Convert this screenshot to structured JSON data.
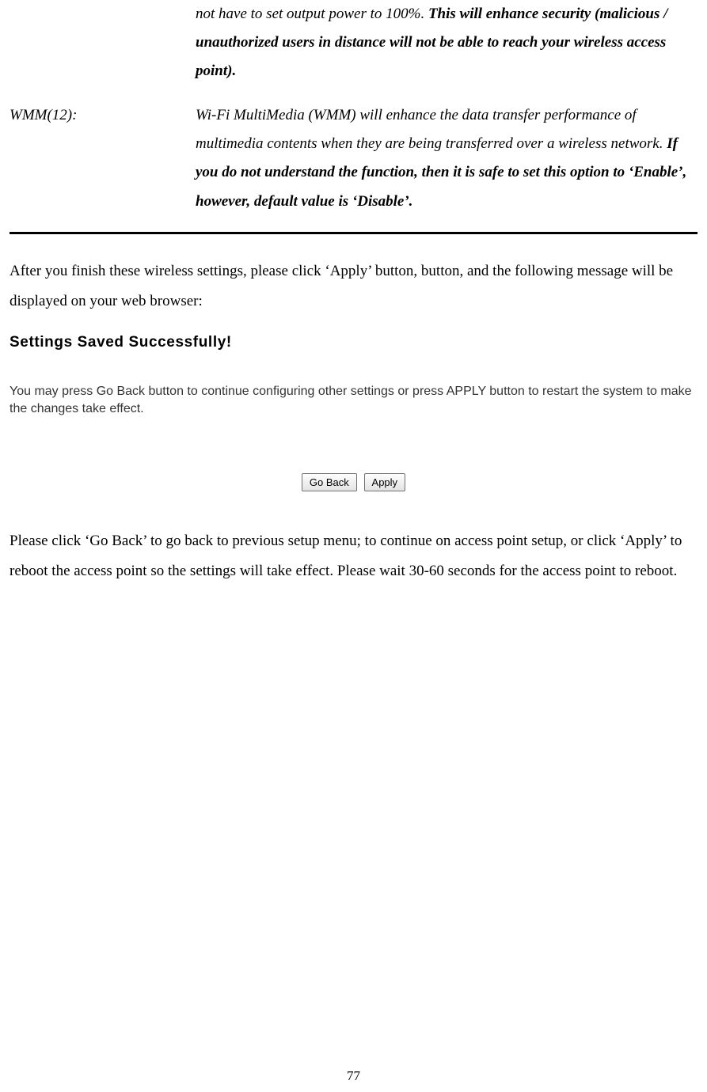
{
  "section1": {
    "desc_part1": "not have to set output power to 100%. ",
    "desc_bold": "This will enhance security (malicious / unauthorized users in distance will not be able to reach your wireless access point)."
  },
  "section2": {
    "term": "WMM(12):",
    "desc_part1": "Wi-Fi MultiMedia (WMM) will enhance the data transfer performance of multimedia contents when they are being transferred over a wireless network. ",
    "desc_bold": "If you do not understand the function, then it is safe to set this option to ‘Enable’, however, default value is ‘Disable’."
  },
  "paragraph1": "After you finish these wireless settings, please click ‘Apply’ button, button, and the following message will be displayed on your web browser:",
  "dialog": {
    "heading": "Settings Saved Successfully!",
    "text": "You may press Go Back button to continue configuring other settings or press APPLY button to restart the system to make the changes take effect.",
    "go_back": "Go Back",
    "apply": "Apply"
  },
  "paragraph2": "Please click ‘Go Back’ to go back to previous setup menu; to continue on access point setup, or click ‘Apply’ to reboot the access point so the settings will take effect. Please wait 30-60 seconds for the access point to reboot.",
  "page_number": "77"
}
